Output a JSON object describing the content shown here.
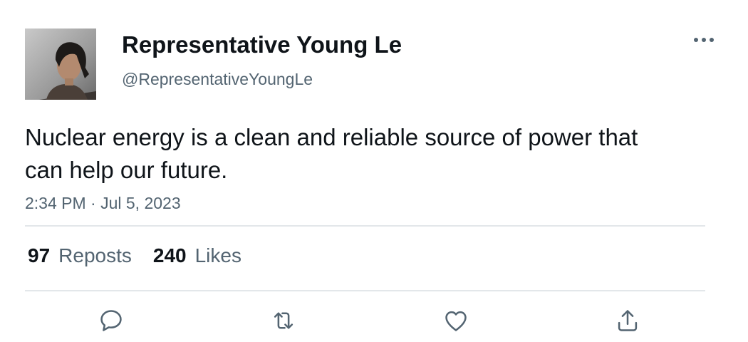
{
  "author": {
    "display_name": "Representative Young Le",
    "handle": "@RepresentativeYoungLe",
    "avatar_icon": "profile-photo"
  },
  "post": {
    "text": "Nuclear energy is a clean and reliable source of power that can help our future.",
    "timestamp": "2:34 PM · Jul 5, 2023"
  },
  "stats": {
    "reposts_count": "97",
    "reposts_label": "Reposts",
    "likes_count": "240",
    "likes_label": "Likes"
  },
  "actions": {
    "reply_icon": "speech-bubble",
    "repost_icon": "retweet-arrows",
    "like_icon": "heart",
    "share_icon": "upload-arrow"
  },
  "colors": {
    "primary_text": "#0f1419",
    "secondary_text": "#536471",
    "divider": "#e3e7ea"
  }
}
